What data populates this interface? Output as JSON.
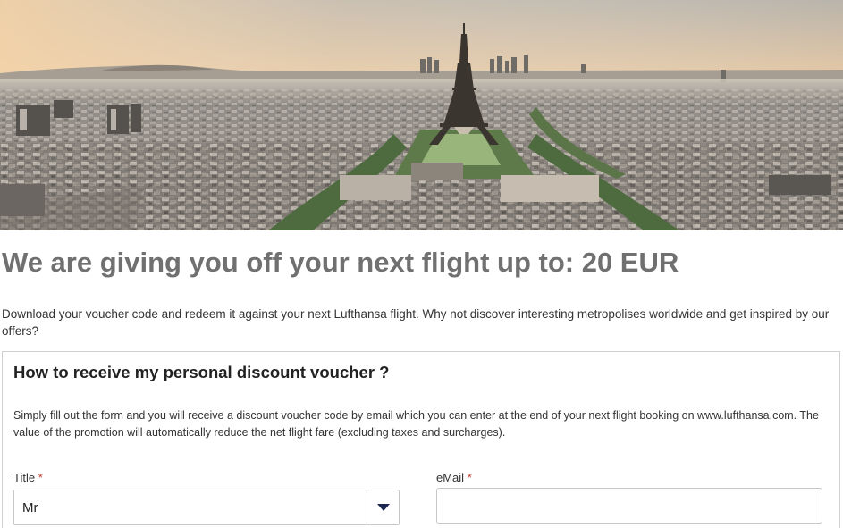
{
  "hero": {
    "image_subject": "Aerial view of Paris skyline with the Eiffel Tower at sunset"
  },
  "headline": "We are giving you off your next flight up to: 20 EUR",
  "intro": "Download your voucher code and redeem it against your next Lufthansa flight. Why not discover interesting metropolises worldwide and get inspired by our offers?",
  "panel": {
    "title": "How to receive my personal discount voucher ?",
    "description": "Simply fill out the form and you will receive a discount voucher code by email which you can enter at the end of your next flight booking on www.lufthansa.com. The value of the promotion will automatically reduce the net flight fare (excluding taxes and surcharges).",
    "form": {
      "title_label": "Title",
      "title_required_marker": "*",
      "title_value": "Mr",
      "email_label": "eMail",
      "email_required_marker": "*",
      "email_value": "",
      "email_placeholder": ""
    }
  },
  "colors": {
    "headline": "#707070",
    "required_marker": "#c0392b",
    "border": "#c8c8c8",
    "dropdown_arrow": "#1c2850"
  },
  "icons": {
    "select_arrow": "chevron-down-icon"
  }
}
